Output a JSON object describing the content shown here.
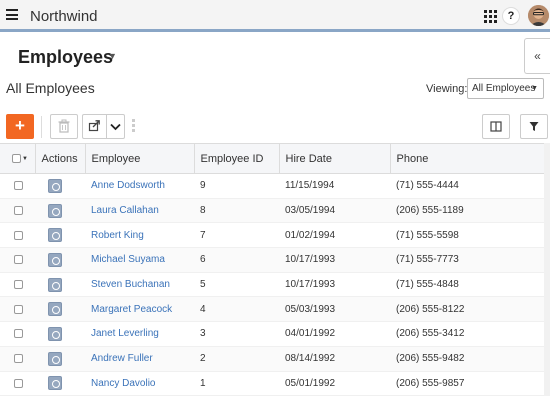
{
  "app": {
    "title": "Northwind"
  },
  "header": {
    "page_title": "Employees",
    "view_name": "All Employees",
    "viewing_label": "Viewing:",
    "viewing_value": "All Employees",
    "collapse_label": "«"
  },
  "toolbar": {
    "add_label": "+"
  },
  "table": {
    "columns": [
      "Actions",
      "Employee",
      "Employee ID",
      "Hire Date",
      "Phone"
    ],
    "rows": [
      {
        "name": "Anne Dodsworth",
        "id": "9",
        "hire_date": "11/15/1994",
        "phone": "(71) 555-4444"
      },
      {
        "name": "Laura Callahan",
        "id": "8",
        "hire_date": "03/05/1994",
        "phone": "(206) 555-1189"
      },
      {
        "name": "Robert King",
        "id": "7",
        "hire_date": "01/02/1994",
        "phone": "(71) 555-5598"
      },
      {
        "name": "Michael Suyama",
        "id": "6",
        "hire_date": "10/17/1993",
        "phone": "(71) 555-7773"
      },
      {
        "name": "Steven Buchanan",
        "id": "5",
        "hire_date": "10/17/1993",
        "phone": "(71) 555-4848"
      },
      {
        "name": "Margaret Peacock",
        "id": "4",
        "hire_date": "05/03/1993",
        "phone": "(206) 555-8122"
      },
      {
        "name": "Janet Leverling",
        "id": "3",
        "hire_date": "04/01/1992",
        "phone": "(206) 555-3412"
      },
      {
        "name": "Andrew Fuller",
        "id": "2",
        "hire_date": "08/14/1992",
        "phone": "(206) 555-9482"
      },
      {
        "name": "Nancy Davolio",
        "id": "1",
        "hire_date": "05/01/1992",
        "phone": "(206) 555-9857"
      }
    ]
  },
  "icons": [
    "menu-icon",
    "apps-grid-icon",
    "help-icon",
    "user-avatar",
    "trash-icon",
    "export-icon",
    "chevron-down-icon",
    "columns-icon",
    "filter-icon",
    "row-action-icon"
  ],
  "colors": {
    "accent": "#f26722",
    "link": "#3b73b9",
    "topbar_border": "#8aa6c6",
    "action_icon": "#95a7bf"
  }
}
